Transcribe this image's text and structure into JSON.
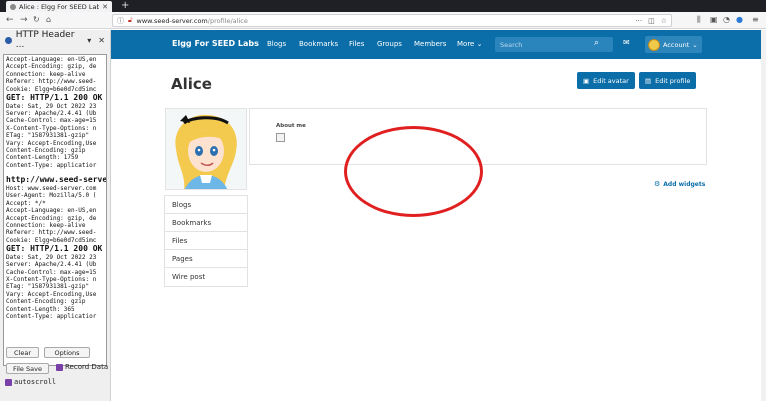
{
  "browser": {
    "tab_title": "Alice : Elgg For SEED Lab",
    "new_tab": "+",
    "url_host": "www.seed-server.com",
    "url_path": "/profile/alice",
    "url_dots": "···"
  },
  "sidebar": {
    "title": "HTTP Header ...",
    "log_lines": [
      {
        "t": "Accept-Language: en-US,en",
        "big": false
      },
      {
        "t": "Accept-Encoding: gzip, de",
        "big": false
      },
      {
        "t": "Connection: keep-alive",
        "big": false
      },
      {
        "t": "Referer: http://www.seed-",
        "big": false
      },
      {
        "t": "Cookie: Elgg=b6e0d7cd5imc",
        "big": false
      },
      {
        "t": "GET: HTTP/1.1 200 OK",
        "big": true
      },
      {
        "t": "Date: Sat, 29 Oct 2022 23",
        "big": false
      },
      {
        "t": "Server: Apache/2.4.41 (Ub",
        "big": false
      },
      {
        "t": "Cache-Control: max-age=15",
        "big": false
      },
      {
        "t": "X-Content-Type-Options: n",
        "big": false
      },
      {
        "t": "ETag: \"1587931381-gzip\"",
        "big": false
      },
      {
        "t": "Vary: Accept-Encoding,Use",
        "big": false
      },
      {
        "t": "Content-Encoding: gzip",
        "big": false
      },
      {
        "t": "Content-Length: 1759",
        "big": false
      },
      {
        "t": "Content-Type: applicatior",
        "big": false
      },
      {
        "t": "",
        "big": false
      },
      {
        "t": "http://www.seed-serve",
        "big": true
      },
      {
        "t": "Host: www.seed-server.com",
        "big": false
      },
      {
        "t": "User-Agent: Mozilla/5.0 (",
        "big": false
      },
      {
        "t": "Accept: */*",
        "big": false
      },
      {
        "t": "Accept-Language: en-US,en",
        "big": false
      },
      {
        "t": "Accept-Encoding: gzip, de",
        "big": false
      },
      {
        "t": "Connection: keep-alive",
        "big": false
      },
      {
        "t": "Referer: http://www.seed-",
        "big": false
      },
      {
        "t": "Cookie: Elgg=b6e0d7cd5imc",
        "big": false
      },
      {
        "t": "GET: HTTP/1.1 200 OK",
        "big": true
      },
      {
        "t": "Date: Sat, 29 Oct 2022 23",
        "big": false
      },
      {
        "t": "Server: Apache/2.4.41 (Ub",
        "big": false
      },
      {
        "t": "Cache-Control: max-age=15",
        "big": false
      },
      {
        "t": "X-Content-Type-Options: n",
        "big": false
      },
      {
        "t": "ETag: \"1587931381-gzip\"",
        "big": false
      },
      {
        "t": "Vary: Accept-Encoding,Use",
        "big": false
      },
      {
        "t": "Content-Encoding: gzip",
        "big": false
      },
      {
        "t": "Content-Length: 365",
        "big": false
      },
      {
        "t": "Content-Type: applicatior",
        "big": false
      }
    ],
    "clear_label": "Clear",
    "options_label": "Options",
    "file_save_label": "File Save",
    "record_data_label": "Record Data",
    "autoscroll_label": "autoscroll"
  },
  "site": {
    "brand": "Elgg For SEED Labs",
    "menu": [
      "Blogs",
      "Bookmarks",
      "Files",
      "Groups",
      "Members",
      "More"
    ],
    "search_placeholder": "Search",
    "account_label": "Account"
  },
  "profile": {
    "name": "Alice",
    "edit_avatar_label": "Edit avatar",
    "edit_profile_label": "Edit profile",
    "about_label": "About me",
    "add_widgets_label": "Add widgets",
    "owner_menu": [
      "Blogs",
      "Bookmarks",
      "Files",
      "Pages",
      "Wire post"
    ]
  },
  "colors": {
    "brand_blue": "#0b6ea8",
    "annotation_red": "#e02020"
  }
}
